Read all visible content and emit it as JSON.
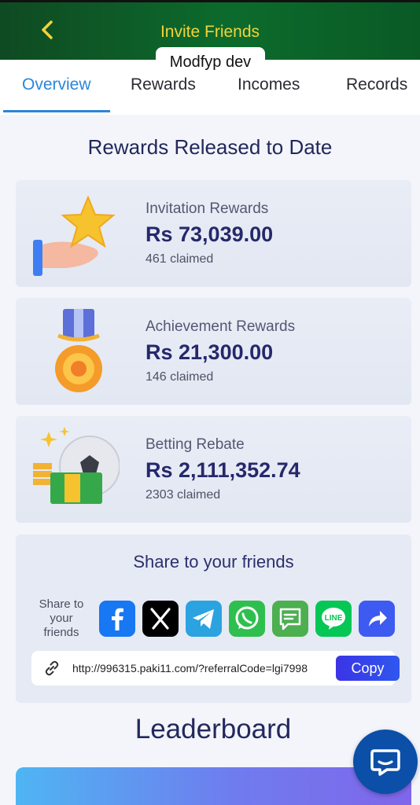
{
  "header": {
    "title": "Invite Friends",
    "back_icon": "chevron-left-icon"
  },
  "watermark": "Modfyp dev",
  "tabs": [
    {
      "label": "Overview",
      "active": true
    },
    {
      "label": "Rewards",
      "active": false
    },
    {
      "label": "Incomes",
      "active": false
    },
    {
      "label": "Records",
      "active": false
    }
  ],
  "section_title": "Rewards Released to Date",
  "rewards": [
    {
      "label": "Invitation Rewards",
      "amount": "Rs 73,039.00",
      "claimed": "461 claimed",
      "icon": "star-hand-icon"
    },
    {
      "label": "Achievement Rewards",
      "amount": "Rs 21,300.00",
      "claimed": "146 claimed",
      "icon": "medal-icon"
    },
    {
      "label": "Betting Rebate",
      "amount": "Rs 2,111,352.74",
      "claimed": "2303 claimed",
      "icon": "football-cash-icon"
    }
  ],
  "share": {
    "title": "Share to your friends",
    "label": "Share to your friends",
    "platforms": [
      {
        "name": "facebook",
        "icon": "facebook-icon",
        "color": "#1877f2"
      },
      {
        "name": "x",
        "icon": "x-icon",
        "color": "#000000"
      },
      {
        "name": "telegram",
        "icon": "telegram-icon",
        "color": "#2aa3e0"
      },
      {
        "name": "whatsapp",
        "icon": "whatsapp-icon",
        "color": "#2fbf4f"
      },
      {
        "name": "sms",
        "icon": "sms-icon",
        "color": "#4caf50"
      },
      {
        "name": "line",
        "icon": "line-icon",
        "color": "#06c755"
      },
      {
        "name": "share",
        "icon": "share-arrow-icon",
        "color": "#3d5af1"
      }
    ],
    "link": "http://996315.paki11.com/?referralCode=lgi7998",
    "copy_label": "Copy"
  },
  "leaderboard_title": "Leaderboard",
  "colors": {
    "header": "#0c6b2c",
    "title": "#f2d33a",
    "active_tab": "#2b86d9",
    "accent": "#3a34e6",
    "chat": "#0b4fa8"
  }
}
